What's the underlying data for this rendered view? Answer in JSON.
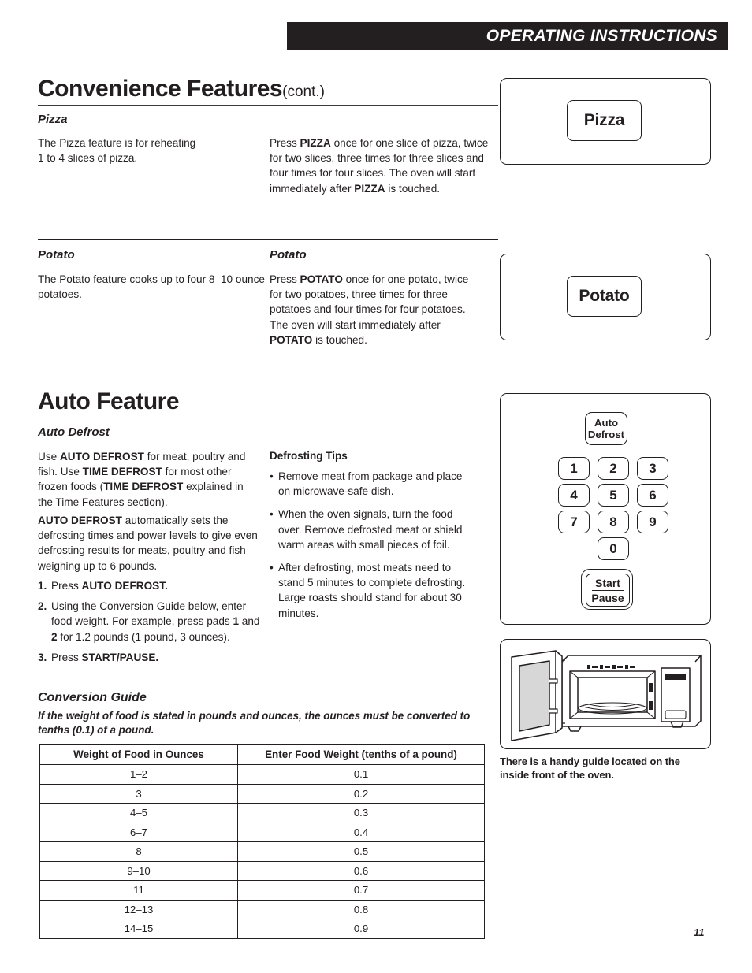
{
  "header": {
    "title": "OPERATING INSTRUCTIONS"
  },
  "convenience": {
    "title": "Convenience Features",
    "cont": "(cont.)",
    "pizza": {
      "heading": "Pizza",
      "left_text_html": "The Pizza feature is for reheating<br>1 to 4 slices of pizza.",
      "right_text_html": "Press <b>PIZZA</b> once for one slice of pizza, twice for two slices, three times for three slices and four times for four slices. The oven will start immediately after <b>PIZZA</b> is touched.",
      "button_label": "Pizza"
    },
    "potato": {
      "heading_left": "Potato",
      "heading_right": "Potato",
      "left_text_html": "The Potato feature cooks up to four 8–10 ounce potatoes.",
      "right_text_html": "Press <b>POTATO</b> once for one potato, twice for two potatoes, three times for three potatoes and four times for four potatoes. The oven will start immediately after <b>POTATO</b> is touched.",
      "button_label": "Potato"
    }
  },
  "auto_feature": {
    "title": "Auto Feature",
    "auto_defrost": {
      "heading": "Auto Defrost",
      "para1_html": "Use <b>AUTO DEFROST</b> for meat, poultry and fish. Use <b>TIME DEFROST</b> for most other frozen foods (<b>TIME DEFROST</b> explained in the Time Features section).",
      "para2_html": "<b>AUTO DEFROST</b> automatically sets the defrosting times and power levels to give even defrosting results for meats, poultry and fish weighing up to 6 pounds.",
      "steps": [
        {
          "num": "1.",
          "html": "Press <b>AUTO DEFROST.</b>"
        },
        {
          "num": "2.",
          "html": "Using the Conversion Guide below, enter food weight. For example, press pads <b>1</b> and <b>2</b> for 1.2 pounds (1 pound, 3 ounces)."
        },
        {
          "num": "3.",
          "html": "Press <b>START/PAUSE.</b>"
        }
      ]
    },
    "defrosting_tips": {
      "heading": "Defrosting Tips",
      "bullets": [
        "Remove meat from package and place on microwave-safe dish.",
        "When the oven signals, turn the food over. Remove defrosted meat or shield warm areas with small pieces of foil.",
        "After defrosting, most meats need to stand 5 minutes to complete defrosting. Large roasts should stand for about 30 minutes."
      ]
    }
  },
  "conversion_guide": {
    "title": "Conversion Guide",
    "note_html": "If the weight of food is stated in pounds and ounces, the ounces must be converted to tenths (0.1) of a pound.",
    "columns": [
      "Weight of Food in Ounces",
      "Enter Food Weight (tenths of a pound)"
    ],
    "rows": [
      [
        "1–2",
        "0.1"
      ],
      [
        "3",
        "0.2"
      ],
      [
        "4–5",
        "0.3"
      ],
      [
        "6–7",
        "0.4"
      ],
      [
        "8",
        "0.5"
      ],
      [
        "9–10",
        "0.6"
      ],
      [
        "11",
        "0.7"
      ],
      [
        "12–13",
        "0.8"
      ],
      [
        "14–15",
        "0.9"
      ]
    ]
  },
  "keypad": {
    "auto_defrost_line1": "Auto",
    "auto_defrost_line2": "Defrost",
    "numbers": [
      "1",
      "2",
      "3",
      "4",
      "5",
      "6",
      "7",
      "8",
      "9"
    ],
    "zero": "0",
    "start": "Start",
    "pause": "Pause"
  },
  "oven_illustration": {
    "caption": "There is a handy guide located on the inside front of the oven."
  },
  "footer": {
    "page_number": "11"
  },
  "colors": {
    "ink": "#231f20",
    "header_bg": "#231f20",
    "header_text": "#ffffff",
    "shadow": "#8e8e8e",
    "door_glass": "#d7d7d7"
  }
}
